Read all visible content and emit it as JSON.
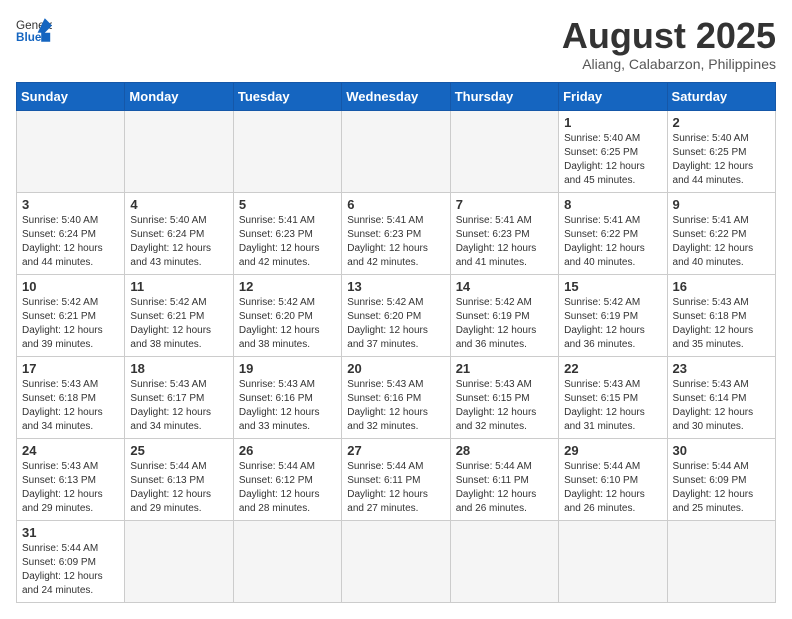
{
  "header": {
    "logo_general": "General",
    "logo_blue": "Blue",
    "title": "August 2025",
    "subtitle": "Aliang, Calabarzon, Philippines"
  },
  "weekdays": [
    "Sunday",
    "Monday",
    "Tuesday",
    "Wednesday",
    "Thursday",
    "Friday",
    "Saturday"
  ],
  "weeks": [
    [
      {
        "day": "",
        "info": ""
      },
      {
        "day": "",
        "info": ""
      },
      {
        "day": "",
        "info": ""
      },
      {
        "day": "",
        "info": ""
      },
      {
        "day": "",
        "info": ""
      },
      {
        "day": "1",
        "info": "Sunrise: 5:40 AM\nSunset: 6:25 PM\nDaylight: 12 hours\nand 45 minutes."
      },
      {
        "day": "2",
        "info": "Sunrise: 5:40 AM\nSunset: 6:25 PM\nDaylight: 12 hours\nand 44 minutes."
      }
    ],
    [
      {
        "day": "3",
        "info": "Sunrise: 5:40 AM\nSunset: 6:24 PM\nDaylight: 12 hours\nand 44 minutes."
      },
      {
        "day": "4",
        "info": "Sunrise: 5:40 AM\nSunset: 6:24 PM\nDaylight: 12 hours\nand 43 minutes."
      },
      {
        "day": "5",
        "info": "Sunrise: 5:41 AM\nSunset: 6:23 PM\nDaylight: 12 hours\nand 42 minutes."
      },
      {
        "day": "6",
        "info": "Sunrise: 5:41 AM\nSunset: 6:23 PM\nDaylight: 12 hours\nand 42 minutes."
      },
      {
        "day": "7",
        "info": "Sunrise: 5:41 AM\nSunset: 6:23 PM\nDaylight: 12 hours\nand 41 minutes."
      },
      {
        "day": "8",
        "info": "Sunrise: 5:41 AM\nSunset: 6:22 PM\nDaylight: 12 hours\nand 40 minutes."
      },
      {
        "day": "9",
        "info": "Sunrise: 5:41 AM\nSunset: 6:22 PM\nDaylight: 12 hours\nand 40 minutes."
      }
    ],
    [
      {
        "day": "10",
        "info": "Sunrise: 5:42 AM\nSunset: 6:21 PM\nDaylight: 12 hours\nand 39 minutes."
      },
      {
        "day": "11",
        "info": "Sunrise: 5:42 AM\nSunset: 6:21 PM\nDaylight: 12 hours\nand 38 minutes."
      },
      {
        "day": "12",
        "info": "Sunrise: 5:42 AM\nSunset: 6:20 PM\nDaylight: 12 hours\nand 38 minutes."
      },
      {
        "day": "13",
        "info": "Sunrise: 5:42 AM\nSunset: 6:20 PM\nDaylight: 12 hours\nand 37 minutes."
      },
      {
        "day": "14",
        "info": "Sunrise: 5:42 AM\nSunset: 6:19 PM\nDaylight: 12 hours\nand 36 minutes."
      },
      {
        "day": "15",
        "info": "Sunrise: 5:42 AM\nSunset: 6:19 PM\nDaylight: 12 hours\nand 36 minutes."
      },
      {
        "day": "16",
        "info": "Sunrise: 5:43 AM\nSunset: 6:18 PM\nDaylight: 12 hours\nand 35 minutes."
      }
    ],
    [
      {
        "day": "17",
        "info": "Sunrise: 5:43 AM\nSunset: 6:18 PM\nDaylight: 12 hours\nand 34 minutes."
      },
      {
        "day": "18",
        "info": "Sunrise: 5:43 AM\nSunset: 6:17 PM\nDaylight: 12 hours\nand 34 minutes."
      },
      {
        "day": "19",
        "info": "Sunrise: 5:43 AM\nSunset: 6:16 PM\nDaylight: 12 hours\nand 33 minutes."
      },
      {
        "day": "20",
        "info": "Sunrise: 5:43 AM\nSunset: 6:16 PM\nDaylight: 12 hours\nand 32 minutes."
      },
      {
        "day": "21",
        "info": "Sunrise: 5:43 AM\nSunset: 6:15 PM\nDaylight: 12 hours\nand 32 minutes."
      },
      {
        "day": "22",
        "info": "Sunrise: 5:43 AM\nSunset: 6:15 PM\nDaylight: 12 hours\nand 31 minutes."
      },
      {
        "day": "23",
        "info": "Sunrise: 5:43 AM\nSunset: 6:14 PM\nDaylight: 12 hours\nand 30 minutes."
      }
    ],
    [
      {
        "day": "24",
        "info": "Sunrise: 5:43 AM\nSunset: 6:13 PM\nDaylight: 12 hours\nand 29 minutes."
      },
      {
        "day": "25",
        "info": "Sunrise: 5:44 AM\nSunset: 6:13 PM\nDaylight: 12 hours\nand 29 minutes."
      },
      {
        "day": "26",
        "info": "Sunrise: 5:44 AM\nSunset: 6:12 PM\nDaylight: 12 hours\nand 28 minutes."
      },
      {
        "day": "27",
        "info": "Sunrise: 5:44 AM\nSunset: 6:11 PM\nDaylight: 12 hours\nand 27 minutes."
      },
      {
        "day": "28",
        "info": "Sunrise: 5:44 AM\nSunset: 6:11 PM\nDaylight: 12 hours\nand 26 minutes."
      },
      {
        "day": "29",
        "info": "Sunrise: 5:44 AM\nSunset: 6:10 PM\nDaylight: 12 hours\nand 26 minutes."
      },
      {
        "day": "30",
        "info": "Sunrise: 5:44 AM\nSunset: 6:09 PM\nDaylight: 12 hours\nand 25 minutes."
      }
    ],
    [
      {
        "day": "31",
        "info": "Sunrise: 5:44 AM\nSunset: 6:09 PM\nDaylight: 12 hours\nand 24 minutes."
      },
      {
        "day": "",
        "info": ""
      },
      {
        "day": "",
        "info": ""
      },
      {
        "day": "",
        "info": ""
      },
      {
        "day": "",
        "info": ""
      },
      {
        "day": "",
        "info": ""
      },
      {
        "day": "",
        "info": ""
      }
    ]
  ]
}
